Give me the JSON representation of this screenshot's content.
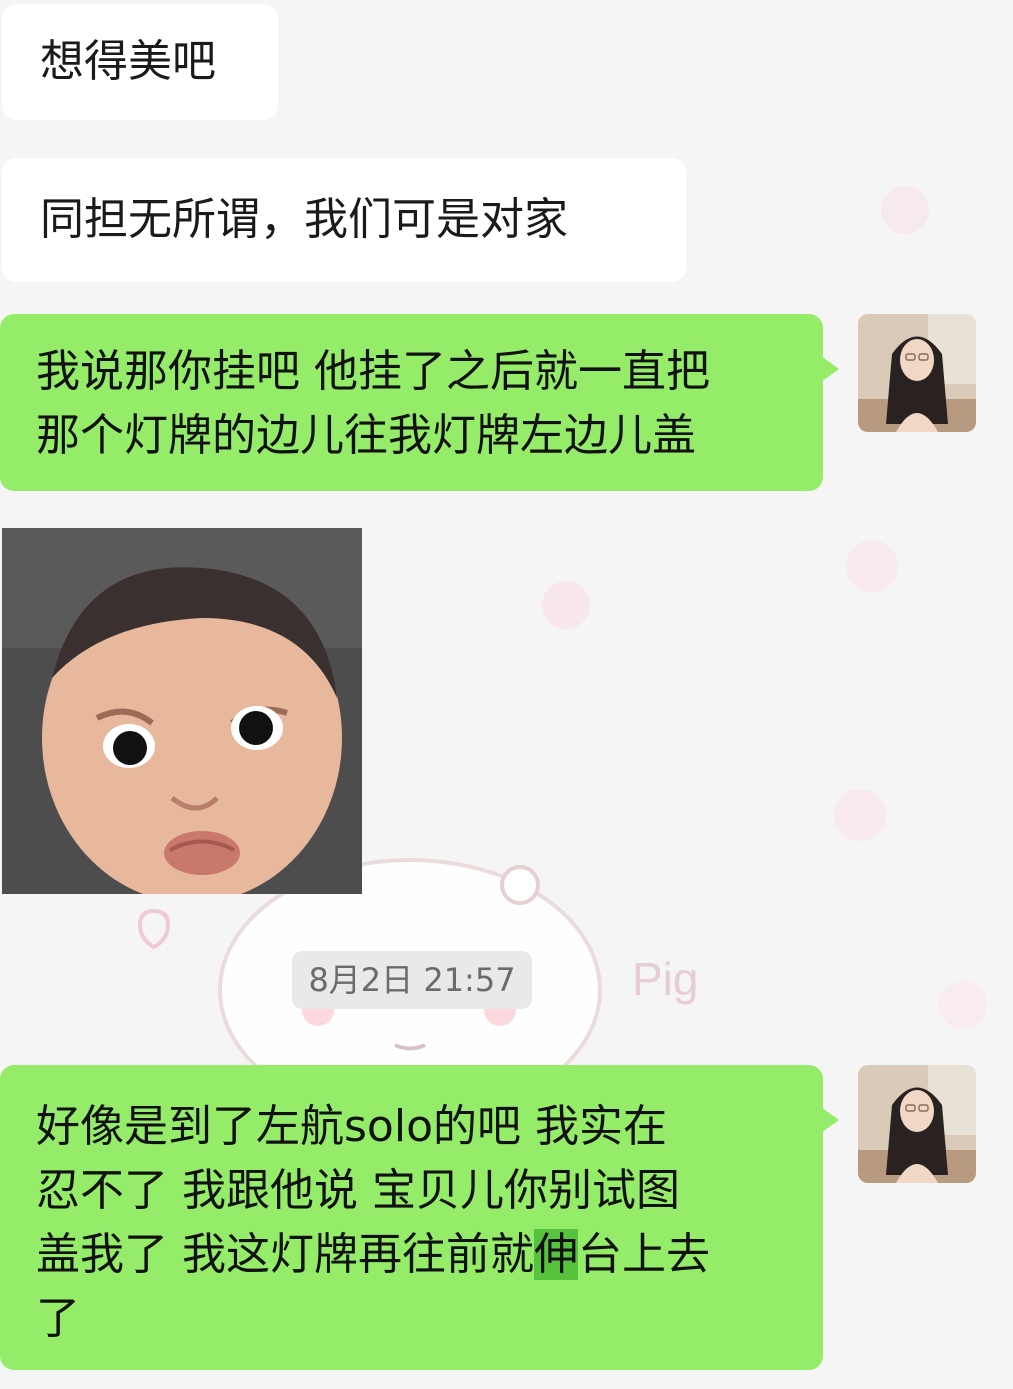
{
  "messages": {
    "m1": "想得美吧",
    "m2": "同担无所谓，我们可是对家",
    "m3": {
      "line1": "我说那你挂吧 他挂了之后就一直把",
      "line2": "那个灯牌的边儿往我灯牌左边儿盖"
    },
    "m4": {
      "line1": "好像是到了左航solo的吧 我实在",
      "line2": "忍不了 我跟他说 宝贝儿你别试图",
      "line3_before": "盖我了 我这灯牌再往前就",
      "line3_highlight": "伸",
      "line3_after": "台上去",
      "line4": "了"
    }
  },
  "timestamp": "8月2日 21:57",
  "background_text": "Pig",
  "colors": {
    "outgoing_bubble": "#95ec69",
    "incoming_bubble": "#ffffff",
    "background": "#f5f5f5",
    "highlight": "#57c23b"
  }
}
